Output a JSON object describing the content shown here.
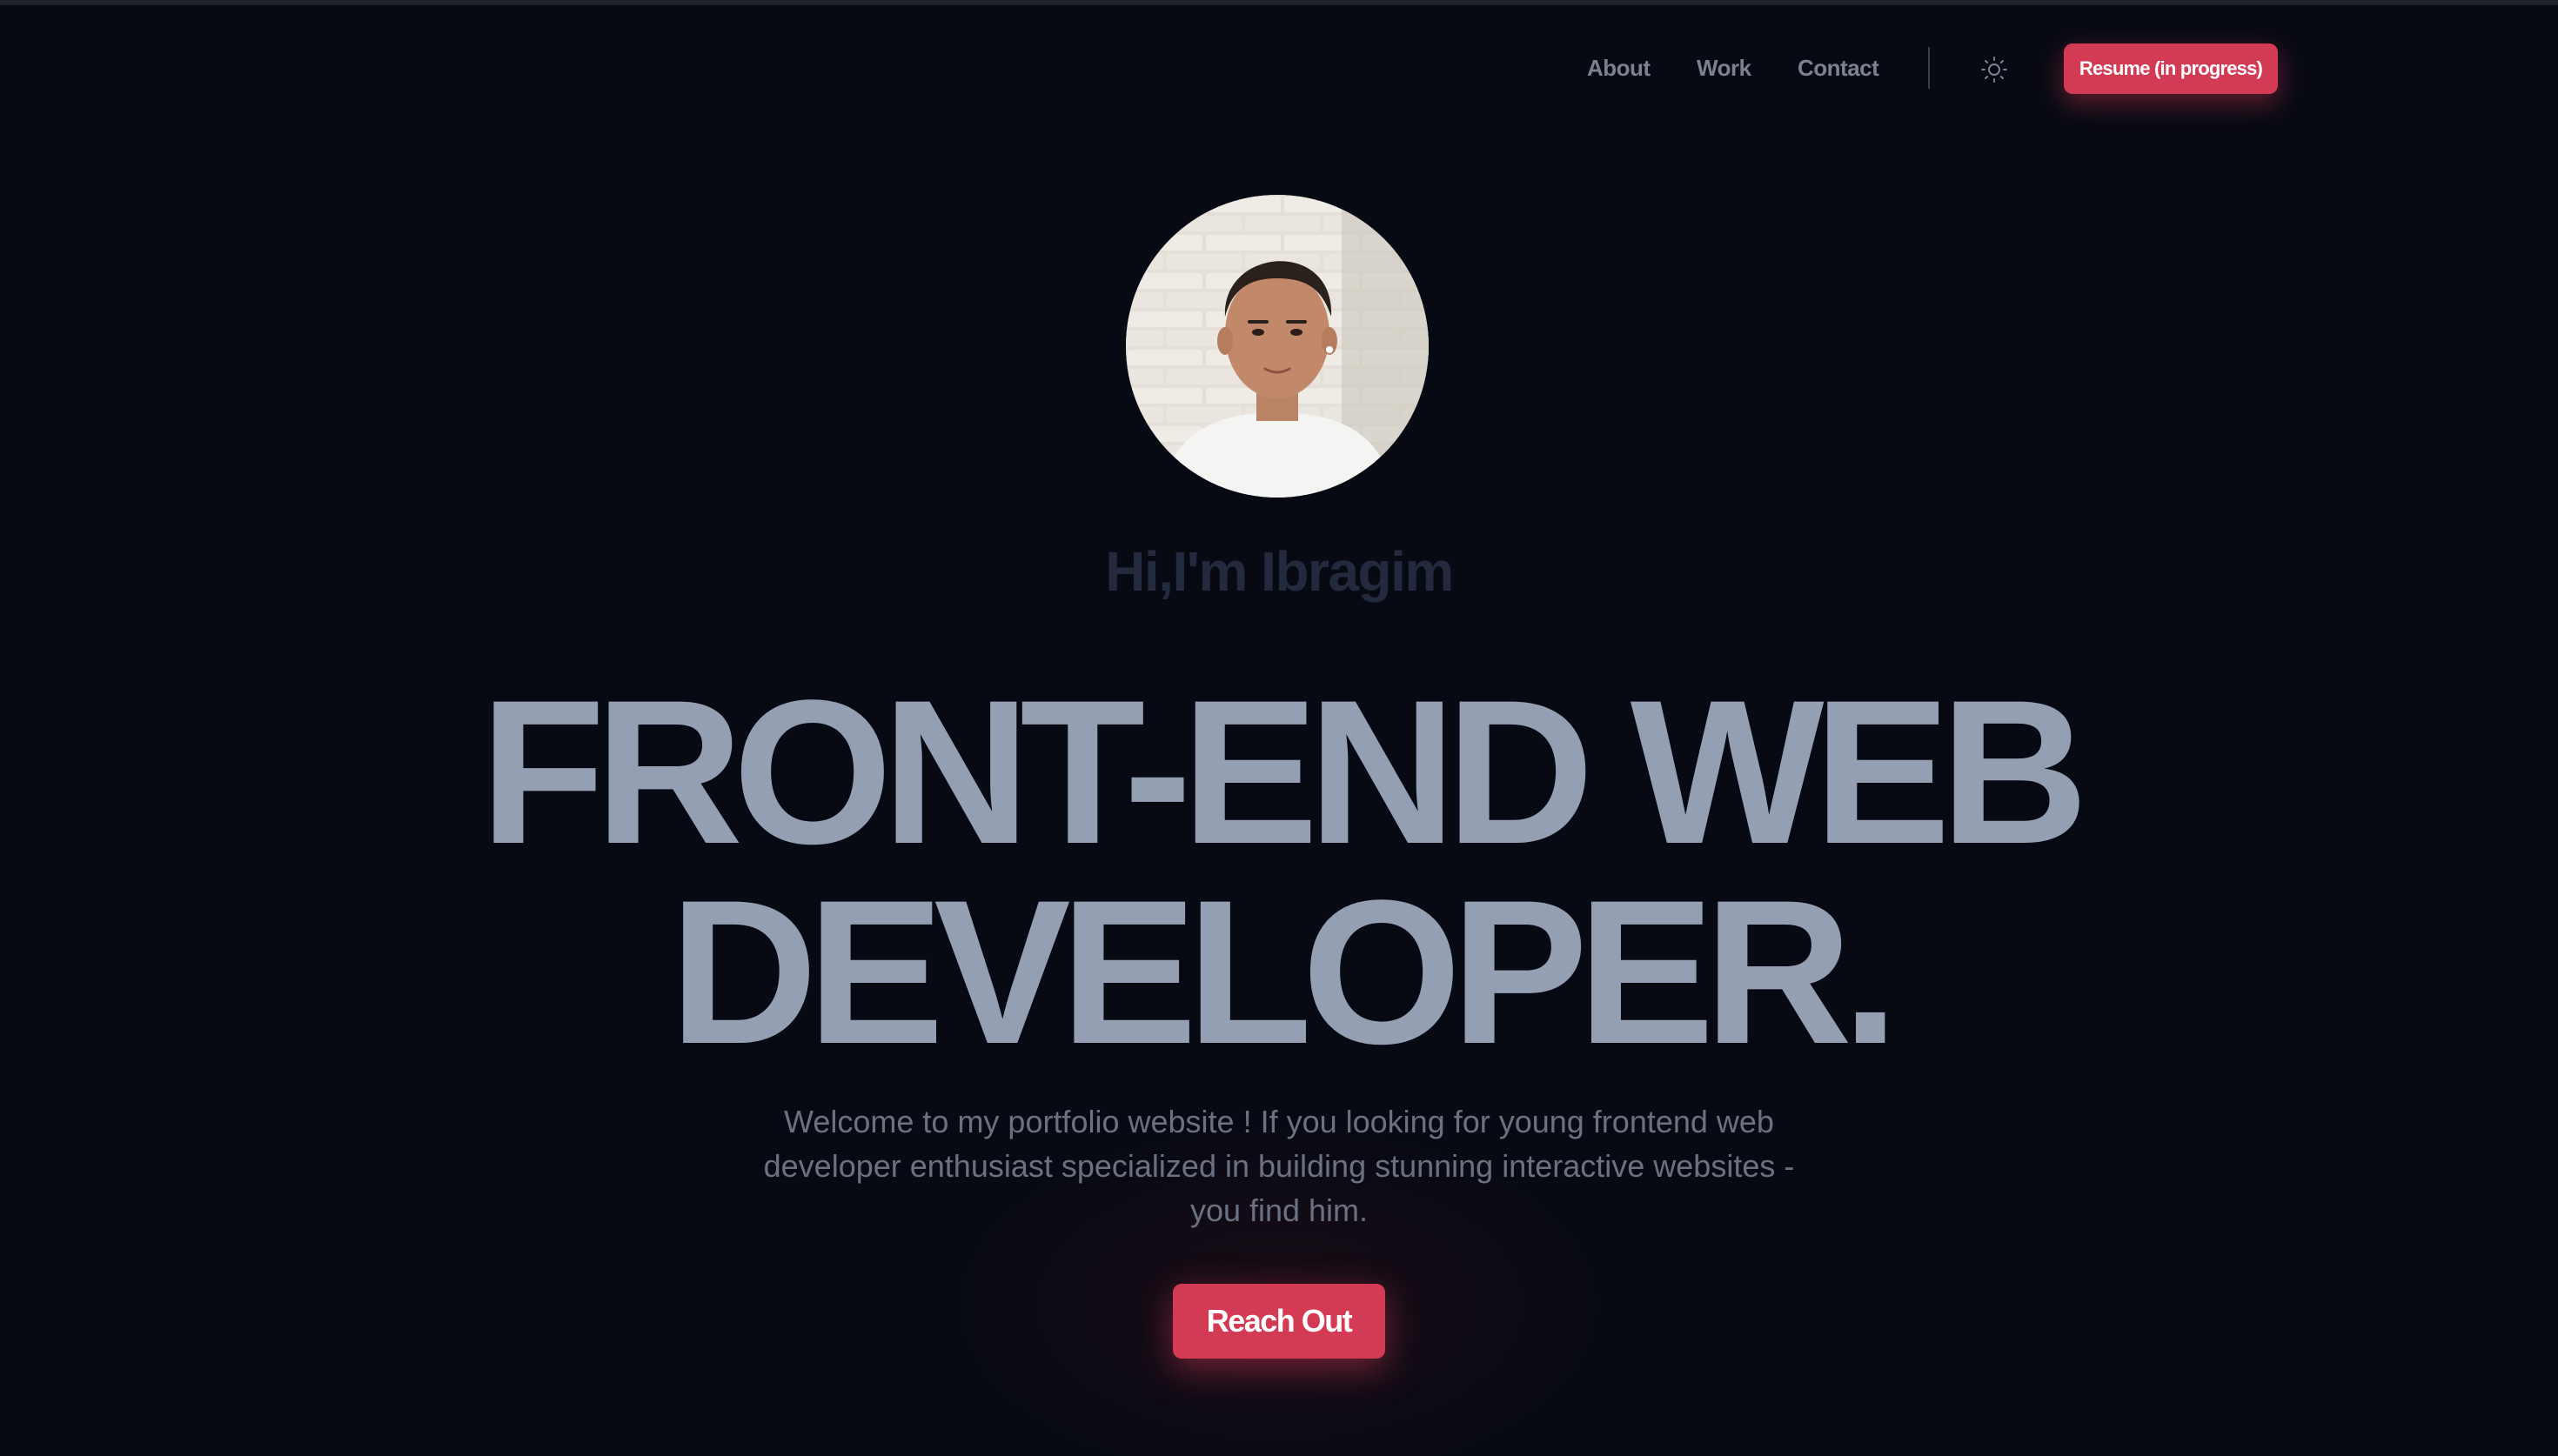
{
  "nav": {
    "about": "About",
    "work": "Work",
    "contact": "Contact",
    "theme_icon": "sun-icon",
    "resume_label": "Resume (in progress)"
  },
  "hero": {
    "avatar_icon": "profile-photo",
    "greeting": "Hi,I'm Ibragim",
    "headline_line1": "FRONT-END WEB",
    "headline_line2": "DEVELOPER.",
    "intro_line1": "Welcome to my portfolio website ! If you looking for young frontend web",
    "intro_line2": "developer enthusiast specialized in building stunning interactive websites -",
    "intro_line3": "you find him.",
    "cta_label": "Reach Out"
  },
  "colors": {
    "background": "#080a13",
    "accent": "#d33a54",
    "headline": "#959fb4",
    "greeting": "#232a3d",
    "nav_text": "#7a8190",
    "body_text": "#6b7181"
  }
}
